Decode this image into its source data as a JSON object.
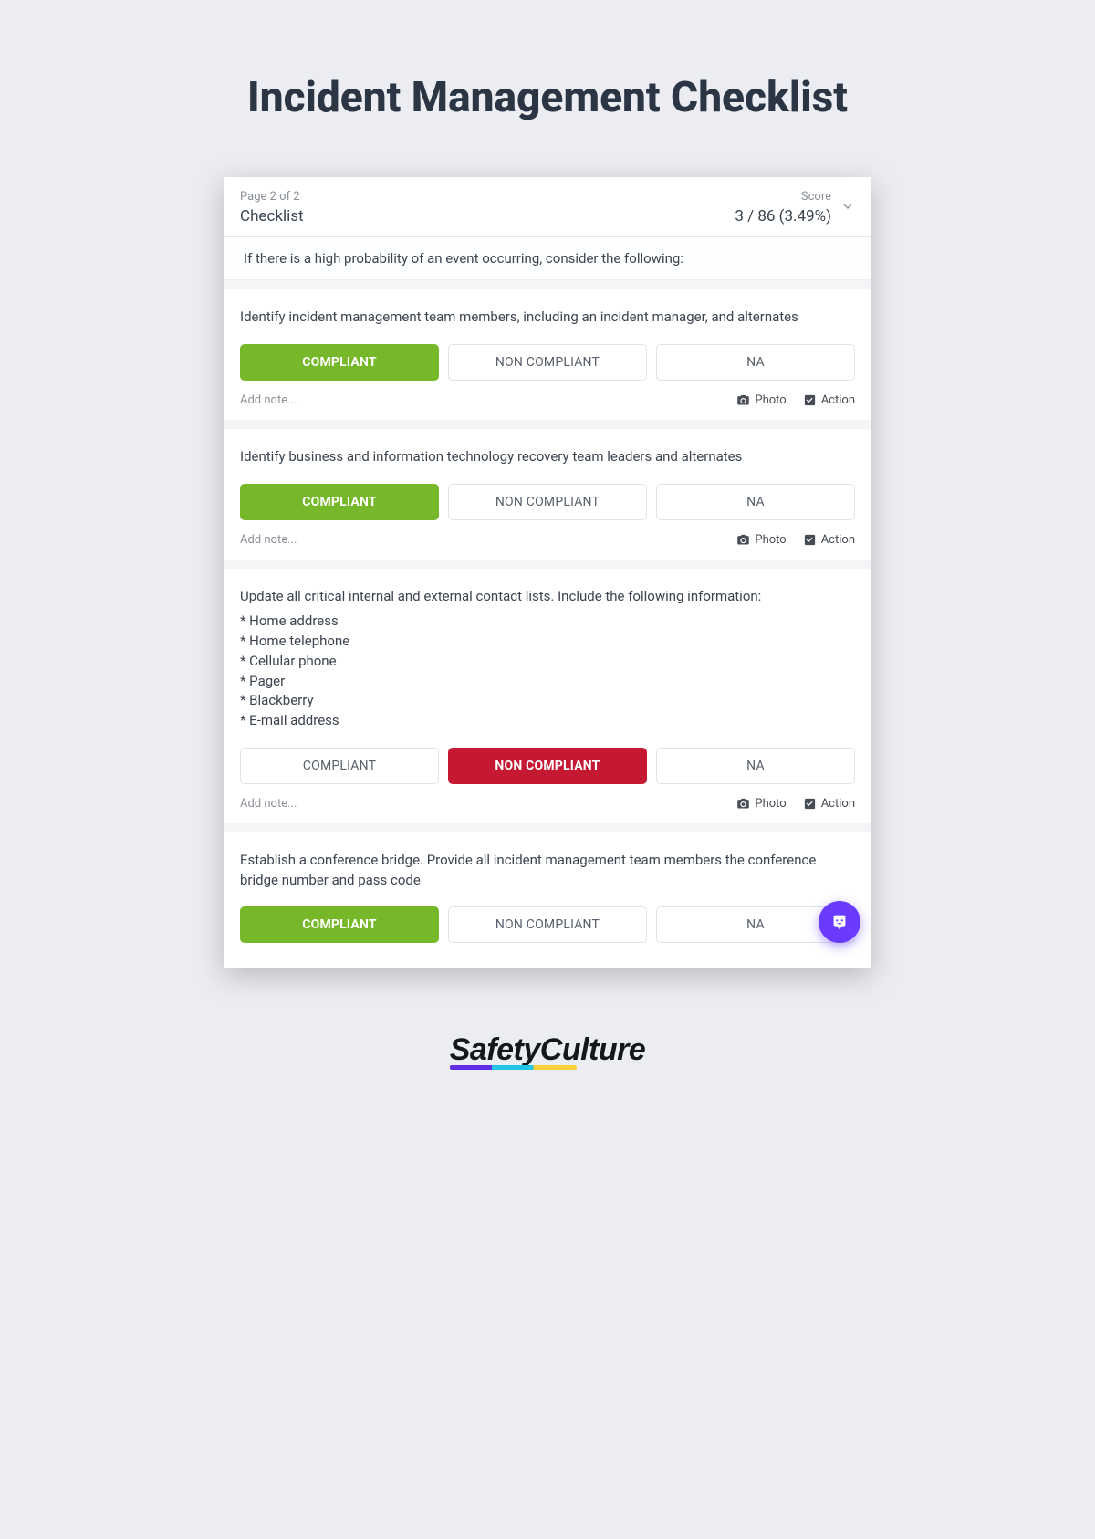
{
  "title": "Incident Management Checklist",
  "header": {
    "pageOf": "Page 2 of 2",
    "section": "Checklist",
    "scoreLabel": "Score",
    "scoreValue": "3 / 86 (3.49%)"
  },
  "intro": "If there is a high probability of an event occurring, consider the following:",
  "buttons": {
    "compliant": "COMPLIANT",
    "nonCompliant": "NON COMPLIANT",
    "na": "NA",
    "addNote": "Add note...",
    "photo": "Photo",
    "action": "Action"
  },
  "items": [
    {
      "question": "Identify incident management team members, including an incident manager, and alternates",
      "selected": "compliant"
    },
    {
      "question": "Identify business and information technology recovery team leaders and alternates",
      "selected": "compliant"
    },
    {
      "question": "Update all critical internal and external contact lists. Include the following information:",
      "list": [
        "* Home address",
        "* Home telephone",
        "* Cellular phone",
        "* Pager",
        "* Blackberry",
        "* E-mail address"
      ],
      "selected": "nonCompliant"
    },
    {
      "question": "Establish a conference bridge. Provide all incident management team members the conference bridge number and pass code",
      "selected": "compliant",
      "hideMeta": true,
      "showFab": true
    }
  ],
  "brand": "SafetyCulture"
}
